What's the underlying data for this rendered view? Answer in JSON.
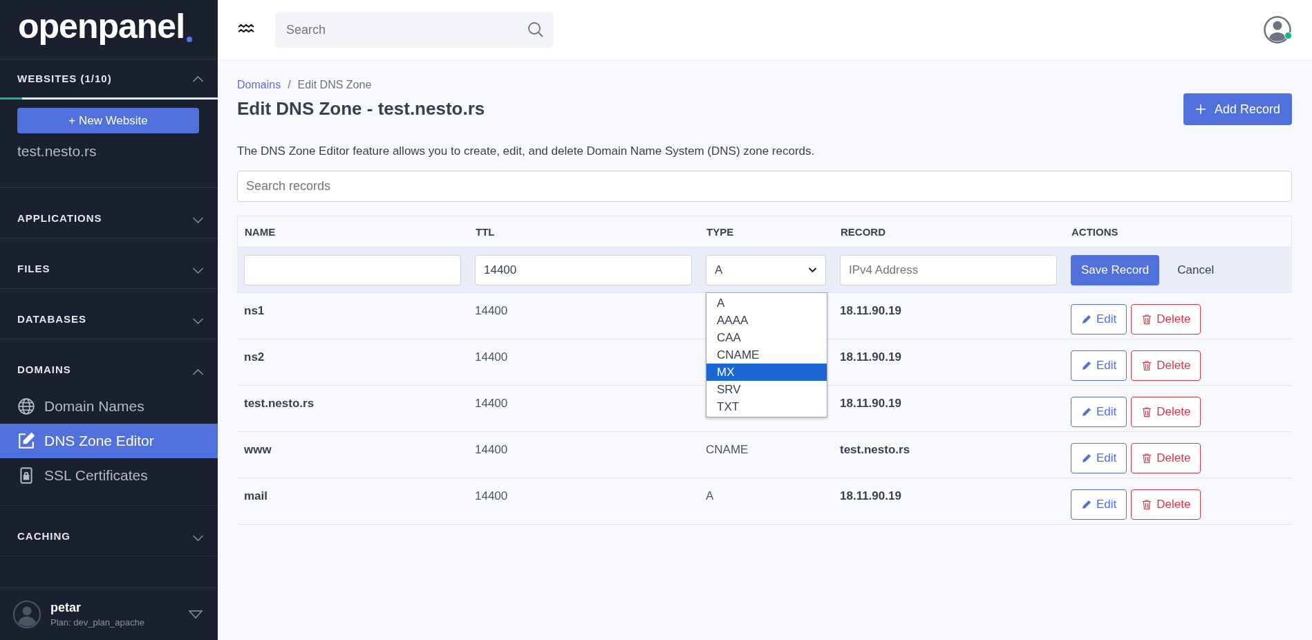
{
  "sidebar": {
    "logo": "openpanel",
    "websites": {
      "title": "WEBSITES (1/10)",
      "expanded": true,
      "level": 0.1,
      "button": "+ New Website",
      "sites": [
        "test.nesto.rs"
      ]
    },
    "sections": [
      {
        "title": "APPLICATIONS",
        "expanded": false
      },
      {
        "title": "FILES",
        "expanded": false
      },
      {
        "title": "DATABASES",
        "expanded": false
      },
      {
        "title": "DOMAINS",
        "expanded": true,
        "items": [
          {
            "label": "Domain Names",
            "selected": false
          },
          {
            "label": "DNS Zone Editor",
            "selected": true
          },
          {
            "label": "SSL Certificates",
            "selected": false
          }
        ]
      },
      {
        "title": "CACHING",
        "expanded": false
      }
    ],
    "user": {
      "name": "petar",
      "plan": "Plan: dev_plan_apache"
    }
  },
  "topbar": {
    "search": {
      "placeholder": "Search"
    },
    "user_online": true
  },
  "breadcrumb_separator": "/",
  "breadcrumb": [
    {
      "label": "Domains",
      "link": true
    },
    {
      "label": "Edit DNS Zone",
      "link": false
    }
  ],
  "title": "Edit DNS Zone - test.nesto.rs",
  "add_button": "Add Record",
  "description": "The DNS Zone Editor feature allows you to create, edit, and delete Domain Name System (DNS) zone records.",
  "records_search": {
    "placeholder": "Search records"
  },
  "table": {
    "columns": [
      "NAME",
      "TTL",
      "TYPE",
      "RECORD",
      "ACTIONS"
    ],
    "new_row": {
      "ttl": "14400",
      "type": "A",
      "record_placeholder": "IPv4 Address",
      "save": "Save Record",
      "cancel": "Cancel",
      "type_options": [
        {
          "label": "A",
          "selected": false
        },
        {
          "label": "AAAA",
          "selected": false
        },
        {
          "label": "CAA",
          "selected": false
        },
        {
          "label": "CNAME",
          "selected": false
        },
        {
          "label": "MX",
          "selected": true
        },
        {
          "label": "SRV",
          "selected": false
        },
        {
          "label": "TXT",
          "selected": false
        }
      ]
    },
    "rows": [
      {
        "name": "ns1",
        "ttl": "14400",
        "record": "18.11.90.19",
        "edit": "Edit",
        "delete": "Delete"
      },
      {
        "name": "ns2",
        "ttl": "14400",
        "record": "18.11.90.19",
        "edit": "Edit",
        "delete": "Delete"
      },
      {
        "name": "test.nesto.rs",
        "ttl": "14400",
        "record": "18.11.90.19",
        "edit": "Edit",
        "delete": "Delete"
      },
      {
        "name": "www",
        "ttl": "14400",
        "type": "CNAME",
        "record": "test.nesto.rs",
        "edit": "Edit",
        "delete": "Delete"
      },
      {
        "name": "mail",
        "ttl": "14400",
        "type": "A",
        "record": "18.11.90.19",
        "edit": "Edit",
        "delete": "Delete"
      }
    ]
  }
}
